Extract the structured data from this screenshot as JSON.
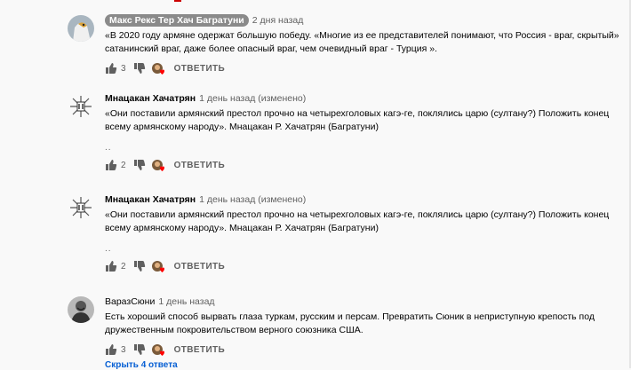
{
  "comments": [
    {
      "author": "Макс Рекс Тер Хач Багратуни",
      "time": "2 дня назад",
      "text": "«В 2020 году армяне одержат большую победу. «Многие из ее представителей понимают, что Россия - враг, скрытый» сатанинский враг, даже более опасный враг, чем очевидный враг - Турция ».",
      "likes": "3",
      "reply": "ОТВЕТИТЬ"
    },
    {
      "author": "Мнацакан Хачатрян",
      "time": "1 день назад (изменено)",
      "text": "«Они поставили армянский престол прочно на четырехголовых кагэ-ге, поклялись царю (султану?) Положить конец всему армянскому народу». Мнацакан Р. Хачатрян (Багратуни)",
      "dots": "..",
      "likes": "2",
      "reply": "ОТВЕТИТЬ"
    },
    {
      "author": "Мнацакан Хачатрян",
      "time": "1 день назад (изменено)",
      "text": "«Они поставили армянский престол прочно на четырехголовых кагэ-ге, поклялись царю (султану?) Положить конец всему армянскому народу». Мнацакан Р. Хачатрян (Багратуни)",
      "dots": "..",
      "likes": "2",
      "reply": "ОТВЕТИТЬ"
    },
    {
      "author": "ВаразСюни",
      "time": "1 день назад",
      "text": "Есть хороший способ вырвать глаза туркам, русским и персам. Превратить Сюник в неприступную крепость под дружественным покровительством верного союзника США.",
      "likes": "3",
      "reply": "ОТВЕТИТЬ"
    }
  ],
  "more_replies": "Скрыть 4 ответа",
  "colors": {
    "background": "#f9f9f9",
    "text": "#030303",
    "meta": "#606060",
    "link": "#065fd4",
    "heart": "#ff0000"
  }
}
